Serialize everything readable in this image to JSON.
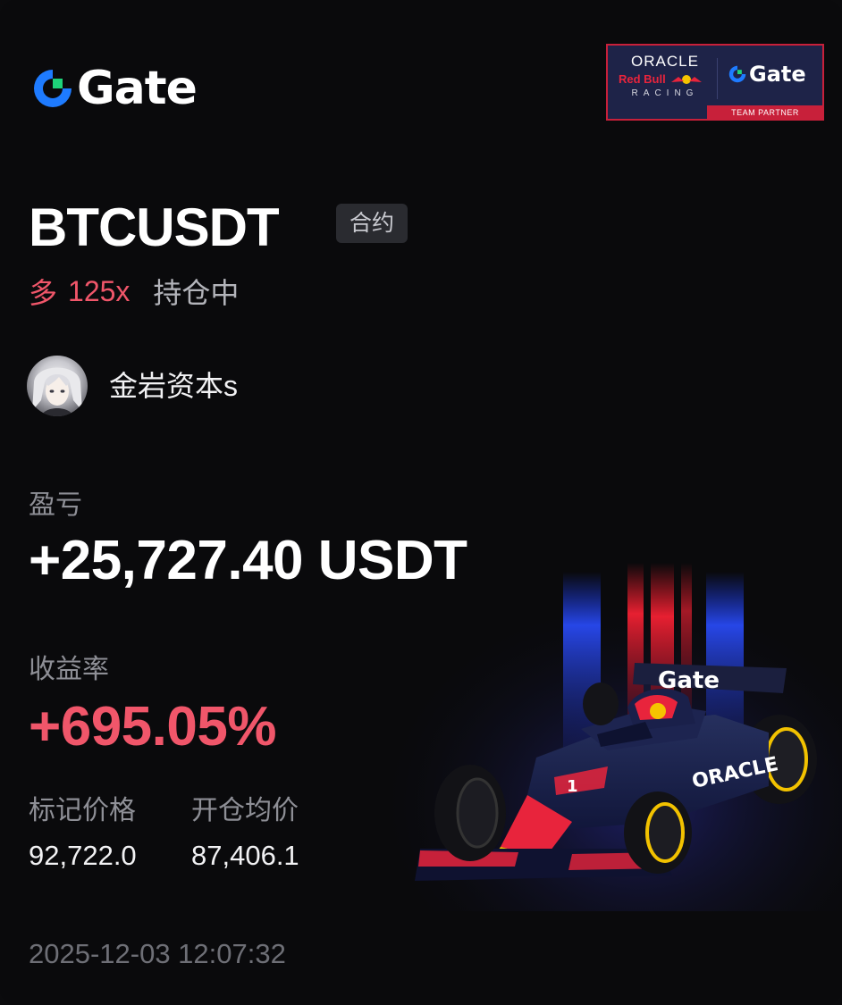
{
  "brand": {
    "logo_text": "Gate",
    "accent": "#1e7bff"
  },
  "partner_badge": {
    "line1": "ORACLE",
    "line2": "Red Bull",
    "line3": "RACING",
    "gate_text": "Gate",
    "strip": "TEAM PARTNER",
    "border_color": "#c8203a"
  },
  "position": {
    "pair": "BTCUSDT",
    "type_tag": "合约",
    "side": "多",
    "leverage": "125x",
    "status": "持仓中"
  },
  "user": {
    "name": "金岩资本s"
  },
  "pnl": {
    "label": "盈亏",
    "value": "+25,727.40 USDT"
  },
  "roi": {
    "label": "收益率",
    "value": "+695.05%",
    "color": "#f0566a"
  },
  "prices": {
    "mark_label": "标记价格",
    "mark_value": "92,722.0",
    "entry_label": "开仓均价",
    "entry_value": "87,406.1"
  },
  "timestamp": "2025-12-03 12:07:32",
  "car": {
    "wing_text": "Gate",
    "side_text": "ORACLE",
    "number": "1"
  }
}
